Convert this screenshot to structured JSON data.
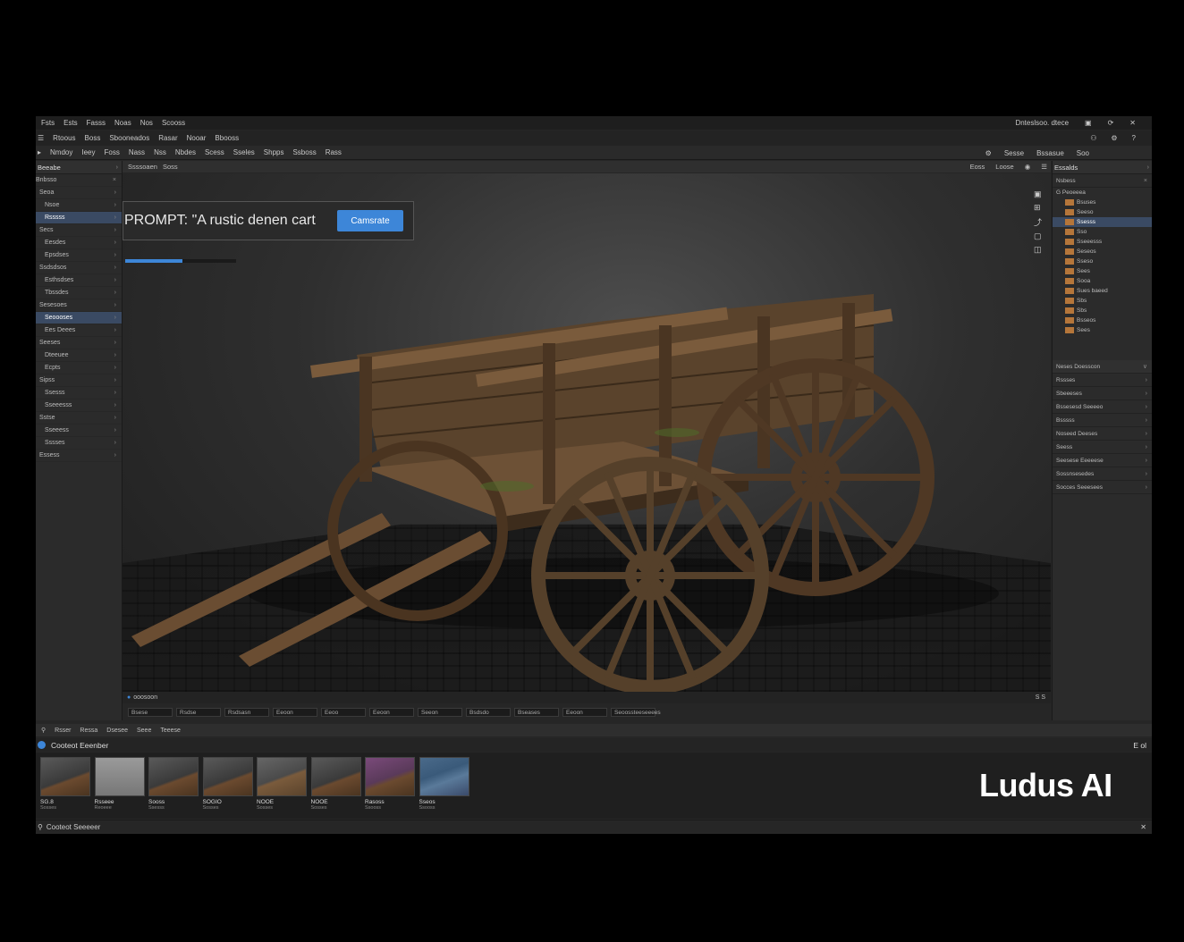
{
  "menubar": {
    "items": [
      "Fsts",
      "Ests",
      "Fasss",
      "Noas",
      "Nos",
      "Scooss"
    ],
    "right_title": "Dnteslsoo. dtece",
    "right_icons": [
      "panel-icon",
      "refresh-icon",
      "close-icon"
    ]
  },
  "toolbar1": {
    "items": [
      "Rtoous",
      "Boss",
      "Sbooneados",
      "Rasar",
      "Nooar",
      "Bbooss"
    ],
    "right_icons": [
      "user-icon",
      "settings-icon",
      "help-icon"
    ]
  },
  "toolbar2": {
    "items": [
      "Nmdoy",
      "Ieey",
      "Foss",
      "Nass",
      "Nss",
      "Nbdes",
      "Scess",
      "Sseles",
      "Shpps",
      "Ssboss",
      "Rass"
    ],
    "right": [
      "Sesse",
      "Bssasue",
      "Soo"
    ]
  },
  "left_panel": {
    "title": "Beeabe",
    "search": "Bnbsso",
    "items": [
      {
        "label": "Seoa",
        "selected": false
      },
      {
        "label": "Nsoe",
        "selected": false
      },
      {
        "label": "Rsssss",
        "selected": true
      },
      {
        "label": "Secs",
        "selected": false
      },
      {
        "label": "Eesdes",
        "selected": false
      },
      {
        "label": "Epsdses",
        "selected": false
      },
      {
        "label": "Ssdsdsos",
        "selected": false
      },
      {
        "label": "Esthsdses",
        "selected": false
      },
      {
        "label": "Tbssdes",
        "selected": false
      },
      {
        "label": "Sesesoes",
        "selected": false
      },
      {
        "label": "Seoooses",
        "selected": true
      },
      {
        "label": "Ees Deees",
        "selected": false
      },
      {
        "label": "Seeses",
        "selected": false
      },
      {
        "label": "Dteeuee",
        "selected": false
      },
      {
        "label": "Ecpts",
        "selected": false
      },
      {
        "label": "Sipss",
        "selected": false
      },
      {
        "label": "Ssesss",
        "selected": false
      },
      {
        "label": "Sseeesss",
        "selected": false
      },
      {
        "label": "Sstse",
        "selected": false
      },
      {
        "label": "Sseeess",
        "selected": false
      },
      {
        "label": "Sssses",
        "selected": false
      },
      {
        "label": "Essess",
        "selected": false
      }
    ]
  },
  "viewport": {
    "tabs": [
      "Ssssoaen",
      "Soss"
    ],
    "right_tabs": [
      "Eoss",
      "Loose"
    ],
    "prompt_text": "PROMPT: \"A rustic denen cart",
    "generate_label": "Camsrate",
    "progress": 0.52,
    "status_label": "ooosoon",
    "status_right": "S S"
  },
  "filter_row": {
    "items": [
      "Bsese",
      "Rsdse",
      "Rsdsasn",
      "Eeoon",
      "Eeoo",
      "Eeoon",
      "Seeon",
      "Bsdsdo",
      "Bseases",
      "Eeoon",
      "Seoossteeseeees"
    ]
  },
  "right_panel": {
    "title": "Essalds",
    "search": "Nsbess",
    "outliner_root": "G Peoeeea",
    "outliner_items": [
      {
        "label": "Bsuses",
        "selected": false
      },
      {
        "label": "Seeso",
        "selected": false
      },
      {
        "label": "Ssesss",
        "selected": true
      },
      {
        "label": "Sso",
        "selected": false
      },
      {
        "label": "Sseeesss",
        "selected": false
      },
      {
        "label": "Seseos",
        "selected": false
      },
      {
        "label": "Sseso",
        "selected": false
      },
      {
        "label": "Sees",
        "selected": false
      },
      {
        "label": "Sooa",
        "selected": false
      },
      {
        "label": "Sues baeed",
        "selected": false
      },
      {
        "label": "Sbs",
        "selected": false
      },
      {
        "label": "Sbs",
        "selected": false
      },
      {
        "label": "Bsseos",
        "selected": false
      },
      {
        "label": "Sees",
        "selected": false
      }
    ],
    "details_title": "Neses Doesscon",
    "details_items": [
      "Rssses",
      "Sbeeeses",
      "Bssesesd Seeeeo",
      "Bsssss",
      "Noseed Deeses",
      "Seess",
      "Seesese Eeeeese",
      "Sossnsesedes",
      "Socces Seeesees"
    ]
  },
  "bottom_tabs": [
    "Rsser",
    "Ressa",
    "Dsesee",
    "Seee",
    "Teeese"
  ],
  "content_browser": {
    "title": "Cooteot Eeenber",
    "right": "E ol",
    "assets": [
      {
        "name": "SG.8",
        "type": "Sosses",
        "thumb": "cart"
      },
      {
        "name": "Rsseee",
        "type": "Reoeee",
        "thumb": "lamp"
      },
      {
        "name": "Sooss",
        "type": "Ssesss",
        "thumb": "cart"
      },
      {
        "name": "SOGIO",
        "type": "Sosses",
        "thumb": "cart"
      },
      {
        "name": "NOOE",
        "type": "Sosses",
        "thumb": "bench"
      },
      {
        "name": "NOOE",
        "type": "Sosses",
        "thumb": "cart"
      },
      {
        "name": "Rasoss",
        "type": "Ssooss",
        "thumb": "purple"
      },
      {
        "name": "Sseos",
        "type": "Ssooss",
        "thumb": "flowers"
      }
    ],
    "footer": "Cooteot Seeeeer"
  },
  "brand": "Ludus AI",
  "colors": {
    "accent": "#3d86d8",
    "selection": "#3a4a63",
    "wood": "#6b4a2f"
  }
}
